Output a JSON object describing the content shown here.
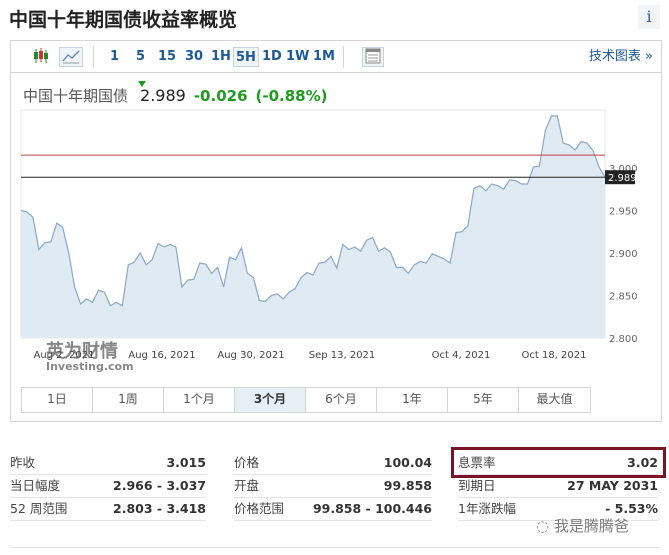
{
  "header": {
    "title": "中国十年期国债收益率概览",
    "info_icon": "i"
  },
  "toolbar": {
    "chart_types": [
      "candlestick-icon",
      "line-chart-icon"
    ],
    "intervals": [
      "1",
      "5",
      "15",
      "30",
      "1H",
      "5H",
      "1D",
      "1W",
      "1M"
    ],
    "selected_interval": "5H",
    "table_icon": "table-icon",
    "tech_chart_label": "技术图表 »"
  },
  "quote": {
    "name": "中国十年期国债",
    "last": "2.989",
    "change": "-0.026",
    "change_pct": "(-0.88%)",
    "direction": "down",
    "color_down": "#1e9b1e"
  },
  "chart_data": {
    "type": "area",
    "y_ticks": [
      "2.800",
      "2.850",
      "2.900",
      "2.950",
      "3.000"
    ],
    "ylim": [
      2.8,
      3.068
    ],
    "x_ticks": [
      "Aug 2, 2021",
      "Aug 16, 2021",
      "Aug 30, 2021",
      "Sep 13, 2021",
      "Oct 4, 2021",
      "Oct 18, 2021"
    ],
    "values": [
      2.95,
      2.948,
      2.942,
      2.904,
      2.912,
      2.913,
      2.935,
      2.93,
      2.9,
      2.86,
      2.84,
      2.846,
      2.842,
      2.856,
      2.854,
      2.838,
      2.842,
      2.838,
      2.886,
      2.889,
      2.9,
      2.886,
      2.892,
      2.911,
      2.907,
      2.91,
      2.907,
      2.86,
      2.868,
      2.869,
      2.888,
      2.887,
      2.876,
      2.883,
      2.86,
      2.895,
      2.892,
      2.906,
      2.876,
      2.871,
      2.844,
      2.843,
      2.85,
      2.852,
      2.846,
      2.854,
      2.858,
      2.871,
      2.877,
      2.874,
      2.888,
      2.889,
      2.896,
      2.882,
      2.91,
      2.904,
      2.907,
      2.902,
      2.915,
      2.918,
      2.902,
      2.906,
      2.901,
      2.883,
      2.883,
      2.876,
      2.886,
      2.89,
      2.888,
      2.899,
      2.896,
      2.893,
      2.888,
      2.924,
      2.925,
      2.932,
      2.976,
      2.979,
      2.973,
      2.981,
      2.979,
      2.975,
      2.986,
      2.985,
      2.981,
      2.981,
      3.001,
      3.002,
      3.044,
      3.061,
      3.061,
      3.029,
      3.027,
      3.021,
      3.031,
      3.029,
      3.02,
      3.001,
      2.989
    ],
    "prev_close_line": 3.015,
    "last_value_line": 2.989,
    "last_label": "2.989",
    "colors": {
      "line": "#8aa8c4",
      "fill": "#dfeaf3",
      "prev_close": "#c0404a",
      "last": "#222222"
    },
    "watermark": {
      "cn": "英为财情",
      "en": "Investing.com"
    }
  },
  "periods": {
    "items": [
      "1日",
      "1周",
      "1个月",
      "3个月",
      "6个月",
      "1年",
      "5年",
      "最大值"
    ],
    "selected": "3个月"
  },
  "stats": {
    "col1": [
      {
        "k": "昨收",
        "v": "3.015"
      },
      {
        "k": "当日幅度",
        "v": "2.966 - 3.037"
      },
      {
        "k": "52 周范围",
        "v": "2.803 - 3.418"
      }
    ],
    "col2": [
      {
        "k": "价格",
        "v": "100.04"
      },
      {
        "k": "开盘",
        "v": "99.858"
      },
      {
        "k": "价格范围",
        "v": "99.858 - 100.446"
      }
    ],
    "col3": [
      {
        "k": "息票率",
        "v": "3.02"
      },
      {
        "k": "到期日",
        "v": "27 MAY 2031"
      },
      {
        "k": "1年涨跌幅",
        "v": "- 5.53%"
      }
    ],
    "highlight_color": "#7a1424"
  },
  "watermark": "我是腾腾爸"
}
